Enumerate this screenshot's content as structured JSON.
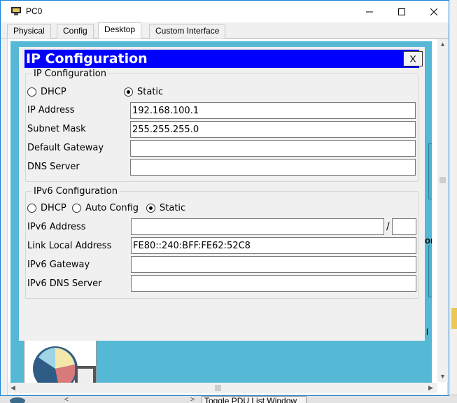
{
  "window": {
    "title": "PC0",
    "minimize": "—",
    "maximize": "☐",
    "close": "✕"
  },
  "tabs": [
    {
      "label": "Physical"
    },
    {
      "label": "Config"
    },
    {
      "label": "Desktop"
    },
    {
      "label": "Custom Interface"
    }
  ],
  "active_tab": "Desktop",
  "ip_configuration": {
    "title": "IP Configuration",
    "close_label": "X",
    "ipv4": {
      "group_label": "IP Configuration",
      "dhcp_label": "DHCP",
      "static_label": "Static",
      "selected": "Static",
      "fields": [
        {
          "label": "IP Address",
          "value": "192.168.100.1"
        },
        {
          "label": "Subnet Mask",
          "value": "255.255.255.0"
        },
        {
          "label": "Default Gateway",
          "value": ""
        },
        {
          "label": "DNS Server",
          "value": ""
        }
      ]
    },
    "ipv6": {
      "group_label": "IPv6 Configuration",
      "dhcp_label": "DHCP",
      "auto_label": "Auto Config",
      "static_label": "Static",
      "selected": "Static",
      "address_label": "IPv6 Address",
      "address_value": "",
      "slash": "/",
      "prefix_value": "",
      "link_local_label": "Link Local Address",
      "link_local_value": "FE80::240:BFF:FE62:52C8",
      "gateway_label": "IPv6 Gateway",
      "gateway_value": "",
      "dns_label": "IPv6 DNS Server",
      "dns_value": ""
    }
  },
  "background": {
    "fragment_1": "r",
    "fragment_2": "or",
    "fragment_3": "l",
    "bottom_button": "Toggle PDU List Window"
  },
  "colors": {
    "header_blue": "#0000ff",
    "desktop_teal": "#55b8d4",
    "window_border": "#1883d7"
  },
  "icons": [
    "app-icon",
    "minimize-icon",
    "maximize-icon",
    "close-icon",
    "pc-desktop-icon",
    "scroll-up-icon",
    "scroll-down-icon",
    "scroll-left-icon",
    "scroll-right-icon"
  ]
}
